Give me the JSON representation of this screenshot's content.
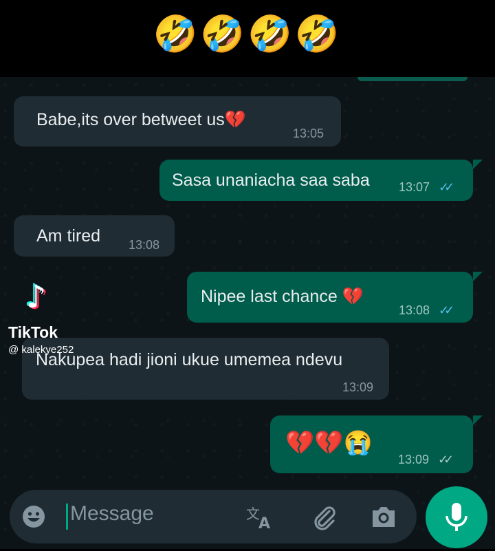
{
  "banner": {
    "emojis": "🤣🤣🤣🤣"
  },
  "messages": [
    {
      "dir": "in",
      "text": "Babe,its over betweet us💔",
      "time": "13:05"
    },
    {
      "dir": "out",
      "text": "Sasa unaniacha saa saba",
      "time": "13:07",
      "status": "read"
    },
    {
      "dir": "in",
      "text": "Am tired",
      "time": "13:08"
    },
    {
      "dir": "out",
      "text": "Nipee last chance 💔",
      "time": "13:08",
      "status": "read"
    },
    {
      "dir": "in",
      "text": "Nakupea hadi jioni ukue umemea ndevu",
      "time": "13:09"
    },
    {
      "dir": "out",
      "text": "💔💔😭",
      "time": "13:09",
      "status": "sent"
    }
  ],
  "watermark": {
    "app": "TikTok",
    "handle": "@ kalekye252"
  },
  "composer": {
    "placeholder": "Message"
  },
  "icons": {
    "emoji": "emoji-icon",
    "translate": "translate-icon",
    "attach": "paperclip-icon",
    "camera": "camera-icon",
    "mic": "microphone-icon",
    "tiktok": "tiktok-logo-icon"
  },
  "colors": {
    "incoming": "#1f2c33",
    "outgoing": "#005c4b",
    "accent": "#00a884",
    "read_ticks": "#53bdeb"
  }
}
